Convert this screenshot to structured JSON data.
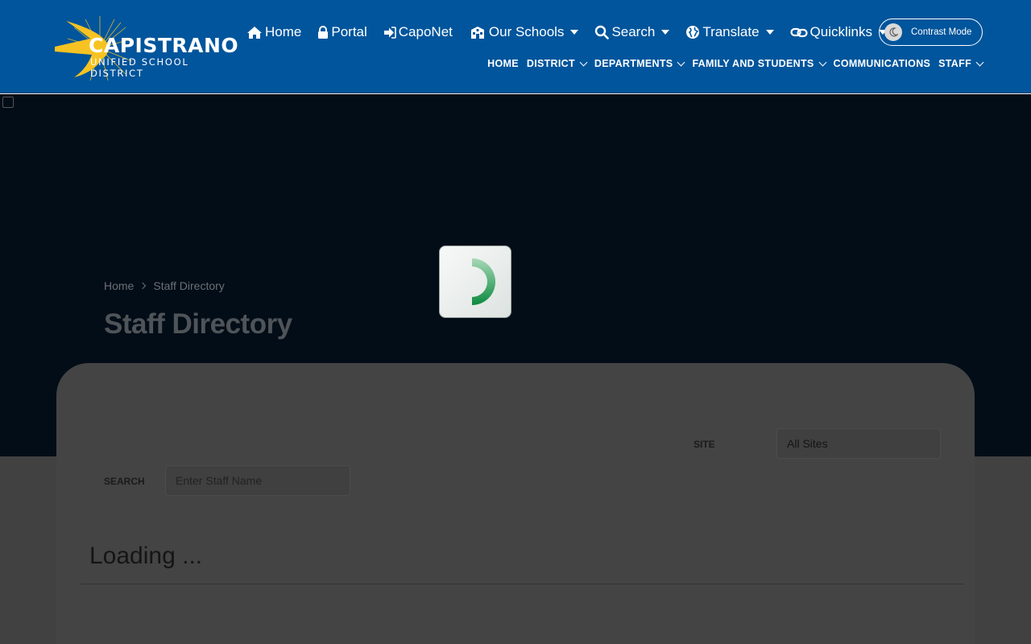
{
  "header": {
    "logo": {
      "name": "CAPISTRANO",
      "subtitle": "UNIFIED SCHOOL DISTRICT"
    },
    "utility_nav": [
      {
        "label": "Home",
        "icon": "home-icon"
      },
      {
        "label": "Portal",
        "icon": "lock-icon"
      },
      {
        "label": "CapoNet",
        "icon": "sign-in-icon"
      },
      {
        "label": "Our Schools",
        "icon": "school-icon",
        "dropdown": true
      },
      {
        "label": "Search",
        "icon": "search-icon",
        "dropdown": true
      },
      {
        "label": "Translate",
        "icon": "globe-icon",
        "dropdown": true
      },
      {
        "label": "Quicklinks",
        "icon": "link-icon",
        "dropdown": true
      }
    ],
    "contrast_toggle": {
      "label": "Contrast Mode",
      "icon": "moon-icon"
    },
    "main_nav": [
      {
        "label": "HOME",
        "dropdown": false
      },
      {
        "label": "DISTRICT",
        "dropdown": true
      },
      {
        "label": "DEPARTMENTS",
        "dropdown": true
      },
      {
        "label": "FAMILY AND STUDENTS",
        "dropdown": true
      },
      {
        "label": "COMMUNICATIONS",
        "dropdown": false
      },
      {
        "label": "STAFF",
        "dropdown": true
      }
    ]
  },
  "hero": {
    "breadcrumb": [
      "Home",
      "Staff Directory"
    ],
    "title": "Staff Directory"
  },
  "filters": {
    "site_label": "SITE",
    "site_value": "All Sites",
    "search_label": "SEARCH",
    "search_placeholder": "Enter Staff Name"
  },
  "status": {
    "loading_text": "Loading ..."
  },
  "colors": {
    "header_bg": "#00559c",
    "logo_sun": "#f6c322",
    "spinner_green": "#0b8a3e"
  }
}
